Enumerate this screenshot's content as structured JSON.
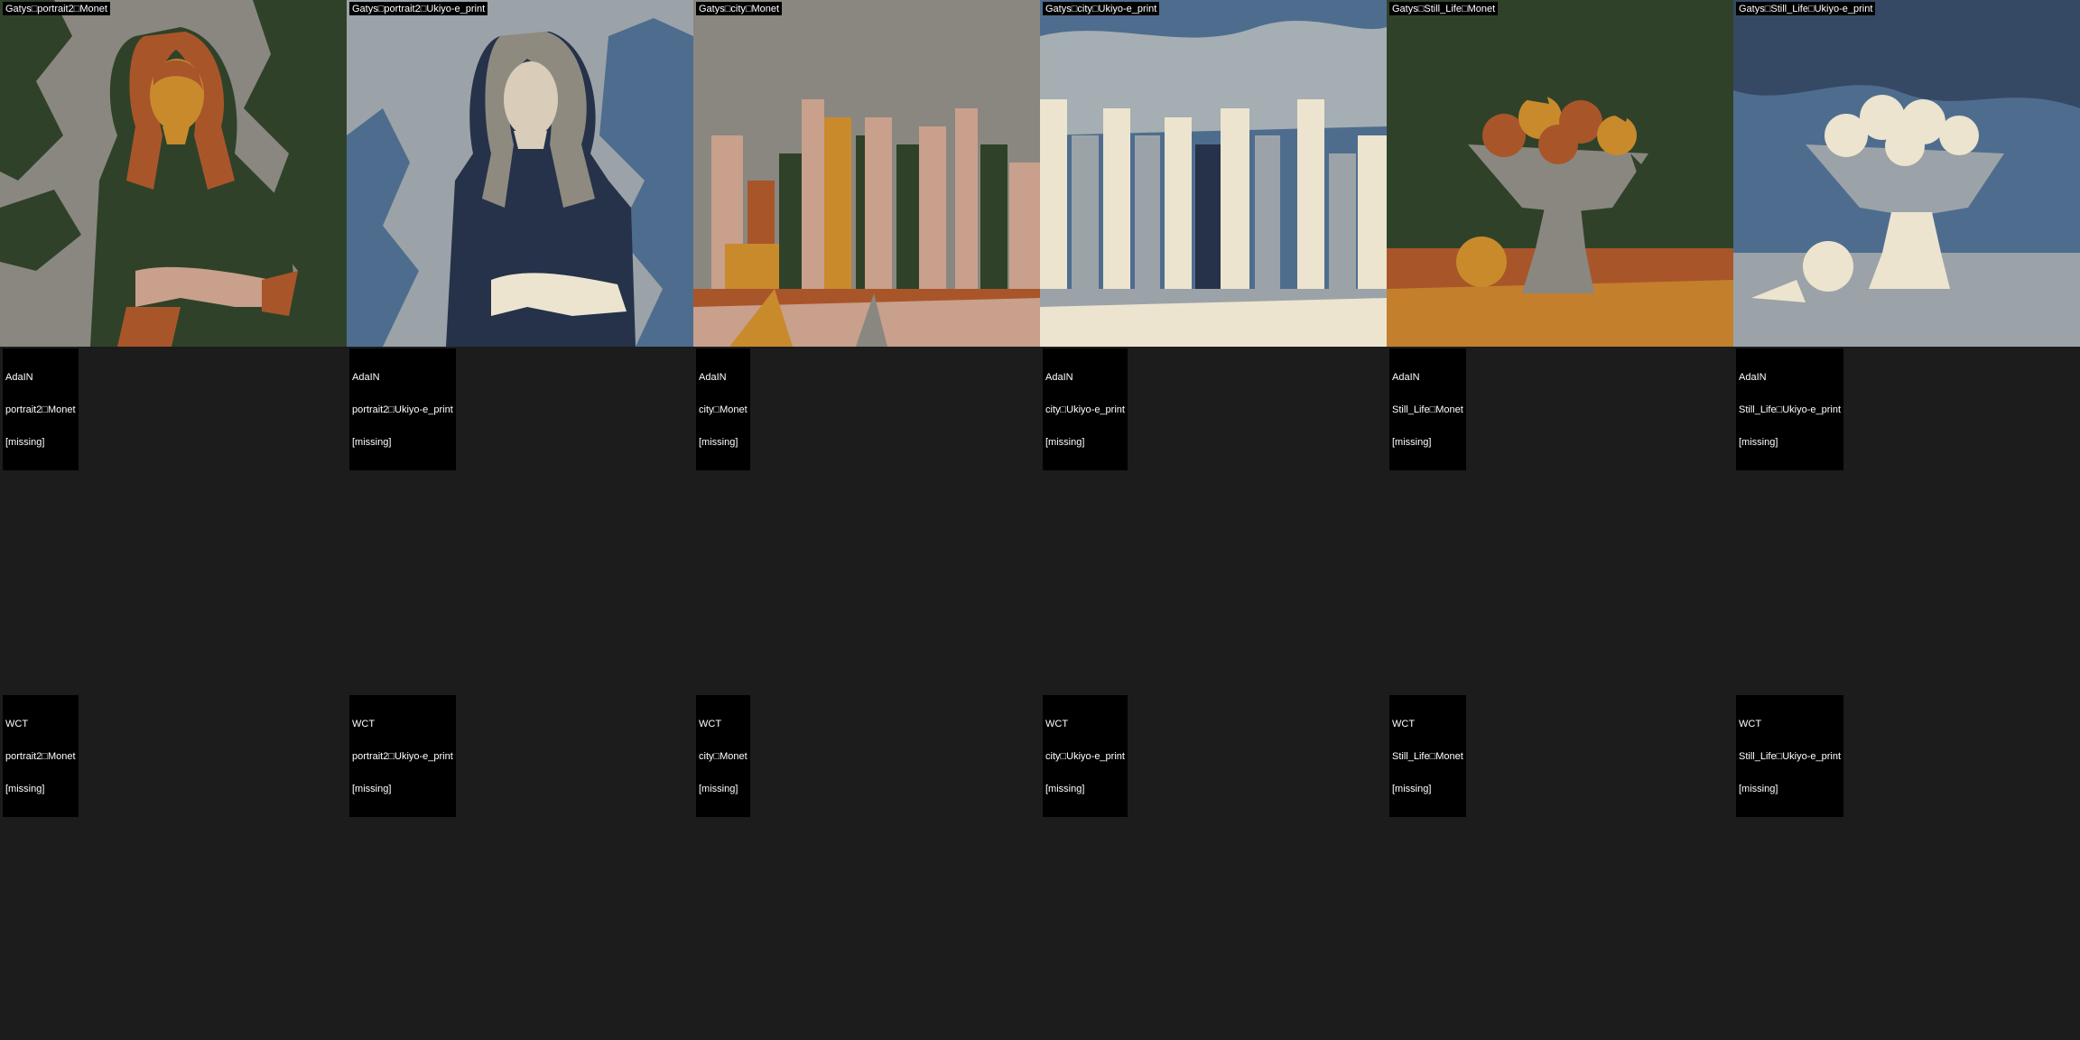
{
  "rows": [
    {
      "method": "Gatys",
      "cells": [
        {
          "label": "Gatys□portrait2□Monet",
          "art": "portrait-monet"
        },
        {
          "label": "Gatys□portrait2□Ukiyo-e_print",
          "art": "portrait-ukiyo"
        },
        {
          "label": "Gatys□city□Monet",
          "art": "city-monet"
        },
        {
          "label": "Gatys□city□Ukiyo-e_print",
          "art": "city-ukiyo"
        },
        {
          "label": "Gatys□Still_Life□Monet",
          "art": "still-life-monet"
        },
        {
          "label": "Gatys□Still_Life□Ukiyo-e_print",
          "art": "still-life-ukiyo"
        }
      ]
    },
    {
      "method": "AdaIN",
      "cells": [
        {
          "lines": [
            "AdaIN",
            "portrait2□Monet",
            "[missing]"
          ]
        },
        {
          "lines": [
            "AdaIN",
            "portrait2□Ukiyo-e_print",
            "[missing]"
          ]
        },
        {
          "lines": [
            "AdaIN",
            "city□Monet",
            "[missing]"
          ]
        },
        {
          "lines": [
            "AdaIN",
            "city□Ukiyo-e_print",
            "[missing]"
          ]
        },
        {
          "lines": [
            "AdaIN",
            "Still_Life□Monet",
            "[missing]"
          ]
        },
        {
          "lines": [
            "AdaIN",
            "Still_Life□Ukiyo-e_print",
            "[missing]"
          ]
        }
      ]
    },
    {
      "method": "WCT",
      "cells": [
        {
          "lines": [
            "WCT",
            "portrait2□Monet",
            "[missing]"
          ]
        },
        {
          "lines": [
            "WCT",
            "portrait2□Ukiyo-e_print",
            "[missing]"
          ]
        },
        {
          "lines": [
            "WCT",
            "city□Monet",
            "[missing]"
          ]
        },
        {
          "lines": [
            "WCT",
            "city□Ukiyo-e_print",
            "[missing]"
          ]
        },
        {
          "lines": [
            "WCT",
            "Still_Life□Monet",
            "[missing]"
          ]
        },
        {
          "lines": [
            "WCT",
            "Still_Life□Ukiyo-e_print",
            "[missing]"
          ]
        }
      ]
    }
  ],
  "colors": {
    "background": "#1c1c1c",
    "label_bg": "#000000",
    "label_text": "#ffffff",
    "monet_green": "#2f4229",
    "monet_gray": "#8a8780",
    "monet_rust": "#a9552a",
    "monet_ochre": "#c98a2c",
    "monet_peach": "#c8a08c",
    "ukiyo_blue": "#4e6d8e",
    "ukiyo_navy": "#25324a",
    "ukiyo_cream": "#ece4cf",
    "ukiyo_gray": "#9ba3a8"
  }
}
